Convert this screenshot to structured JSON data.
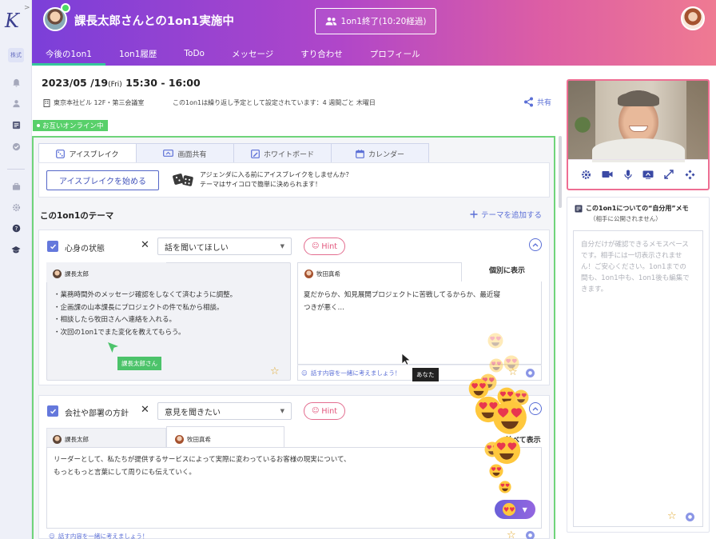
{
  "rail": {
    "badge": "株式"
  },
  "header": {
    "title": "課長太郎さんとの1on1実施中",
    "end_button": "1on1終了(10:20経過)"
  },
  "nav": {
    "tabs": [
      "今後の1on1",
      "1on1履歴",
      "ToDo",
      "メッセージ",
      "すり合わせ",
      "プロフィール"
    ]
  },
  "meeting": {
    "date": "2023/05 /19",
    "weekday": "(Fri)",
    "time": " 15:30 - 16:00",
    "place": "東京本社ビル 12F・第三会議室",
    "repeat": "この1on1は繰り返し予定として設定されています：4 週間ごと 木曜日",
    "share": "共有",
    "online": "お互いオンライン中"
  },
  "icebreak": {
    "tabs": [
      "アイスブレイク",
      "画面共有",
      "ホワイトボード",
      "カレンダー"
    ],
    "start_button": "アイスブレイクを始める",
    "text_line1": "アジェンダに入る前にアイスブレイクをしませんか？",
    "text_line2": "テーマはサイコロで簡単に決められます！"
  },
  "themes": {
    "title": "この1on1のテーマ",
    "add": "テーマを追加する",
    "hint_label": "Hint",
    "consider_label": "話す内容を一緒に考えましょう！",
    "items": [
      {
        "title": "心身の状態",
        "select": "話を聞いてほしい",
        "view_label": "個別に表示",
        "left_name": "課長太郎",
        "left_lines": [
          "・業務時間外のメッセージ確認をしなくて済むように調整。",
          "・企画課の山本課長にプロジェクトの件で私から相談。",
          "・相談したら牧田さんへ連絡を入れる。",
          "・次回の1on1でまた変化を教えてもらう。"
        ],
        "right_name": "牧田真希",
        "right_lines": [
          "夏だからか、知見展開プロジェクトに苦戦してるからか、最近寝",
          "つきが悪く…"
        ]
      },
      {
        "title": "会社や部署の方針",
        "select": "意見を聞きたい",
        "view_label": "並べて表示",
        "left_name": "課長太郎",
        "right_name": "牧田真希",
        "lines": [
          "リーダーとして、私たちが提供するサービスによって実際に変わっているお客様の現実について、",
          "もっともっと言葉にして周りにも伝えていく。"
        ]
      }
    ]
  },
  "cursors": {
    "boss": "課長太郎さん",
    "me": "あなた"
  },
  "private_memo": {
    "title": "この1on1についての“自分用”メモ",
    "subtitle": "（相手に公開されません）",
    "placeholder": "自分だけが確認できるメモスペースです。相手には一切表示されません！ご安心ください。1on1までの間も、1on1中も、1on1後も編集できます。"
  },
  "colors": {
    "brand": "#5b6fd6",
    "online": "#58d06a",
    "hint": "#e2557c",
    "accent_tab": "#36c89b"
  }
}
